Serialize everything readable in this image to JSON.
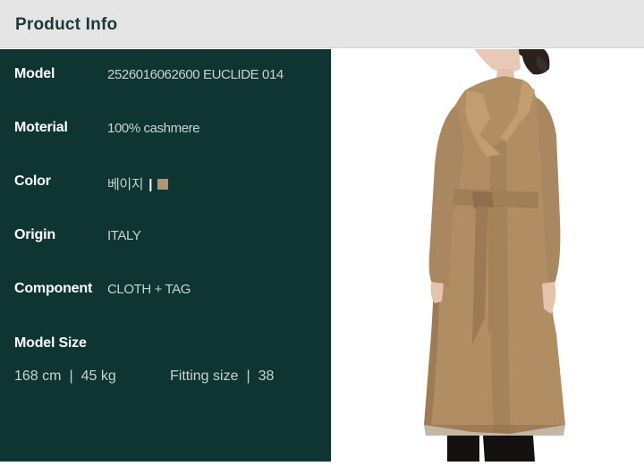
{
  "header": {
    "title": "Product Info"
  },
  "details": [
    {
      "label": "Model",
      "value": "2526016062600 EUCLIDE 014"
    },
    {
      "label": "Moterial",
      "value": "100% cashmere"
    },
    {
      "label": "Color",
      "value": "베이지",
      "separator": "|",
      "swatch_color": "#b29670"
    },
    {
      "label": "Origin",
      "value": "ITALY"
    },
    {
      "label": "Component",
      "value": "CLOTH + TAG"
    }
  ],
  "model_size": {
    "title": "Model Size",
    "height": "168 cm",
    "separator": "|",
    "weight": "45 kg",
    "fitting_label": "Fitting size",
    "fitting_value": "38"
  },
  "colors": {
    "panel": "#0f3533",
    "header_bg": "#e5e5e5",
    "header_text": "#1c3a35",
    "coat": "#b08d63"
  }
}
